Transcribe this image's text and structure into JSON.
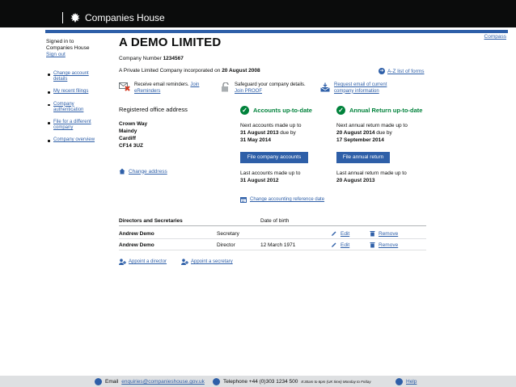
{
  "header": {
    "brand": "Companies House"
  },
  "top_link": "Compass",
  "signed_in": {
    "line1": "Signed in to",
    "line2": "Companies House",
    "sign_out": "Sign out"
  },
  "sidebar": {
    "items": [
      {
        "label": "Change account details"
      },
      {
        "label": "My recent filings"
      },
      {
        "label": "Company authentication"
      },
      {
        "label": "File for a different company"
      },
      {
        "label": "Company overview"
      }
    ]
  },
  "company": {
    "name": "A DEMO LIMITED",
    "number_label": "Company Number",
    "number": "1234567",
    "type_text": "A Private Limited Company incorporated on",
    "incorporated": "20 August 2008",
    "az_link": "A-Z list of forms"
  },
  "promos": {
    "ereminders_text": "Receive email reminders.",
    "ereminders_link1": "Join",
    "ereminders_link2": "eReminders",
    "proof_text": "Safeguard your company details.",
    "proof_link": "Join PROOF",
    "email_info_link1": "Request email of current",
    "email_info_link2": "company information"
  },
  "registered_office": {
    "heading": "Registered office address",
    "address": [
      "Crown Way",
      "Maindy",
      "Cardiff",
      "CF14 3UZ"
    ],
    "change_link": "Change address"
  },
  "accounts": {
    "heading": "Accounts up-to-date",
    "next_label": "Next accounts made up to",
    "next_date": "31 August 2013",
    "due_by": "due by",
    "due_date": "31 May 2014",
    "button": "File company accounts",
    "last_label": "Last accounts made up to",
    "last_date": "31 August 2012",
    "change_ref_link": "Change accounting reference date"
  },
  "annual_return": {
    "heading": "Annual Return up-to-date",
    "next_label": "Next annual return made up to",
    "next_date": "20 August 2014",
    "due_by": "due by",
    "due_date": "17 September 2014",
    "button": "File annual return",
    "last_label": "Last annual return made up to",
    "last_date": "20 August 2013"
  },
  "directors": {
    "heading": "Directors and Secretaries",
    "dob_heading": "Date of birth",
    "rows": [
      {
        "name": "Andrew Demo",
        "role": "Secretary",
        "dob": "",
        "edit": "Edit",
        "remove": "Remove"
      },
      {
        "name": "Andrew Demo",
        "role": "Director",
        "dob": "12 March 1971",
        "edit": "Edit",
        "remove": "Remove"
      }
    ],
    "appoint_director": "Appoint a director",
    "appoint_secretary": "Appoint a secretary"
  },
  "footer": {
    "email_label": "Email",
    "email": "enquiries@companieshouse.gov.uk",
    "phone_label": "Telephone +44 (0)303 1234 500",
    "phone_hours": "8:30am to 6pm (UK time) Monday to Friday",
    "help": "Help"
  },
  "colors": {
    "link": "#2e5fa8",
    "accent_blue": "#2e5fa8",
    "success_green": "#00823b",
    "header_black": "#0b0c0c"
  }
}
